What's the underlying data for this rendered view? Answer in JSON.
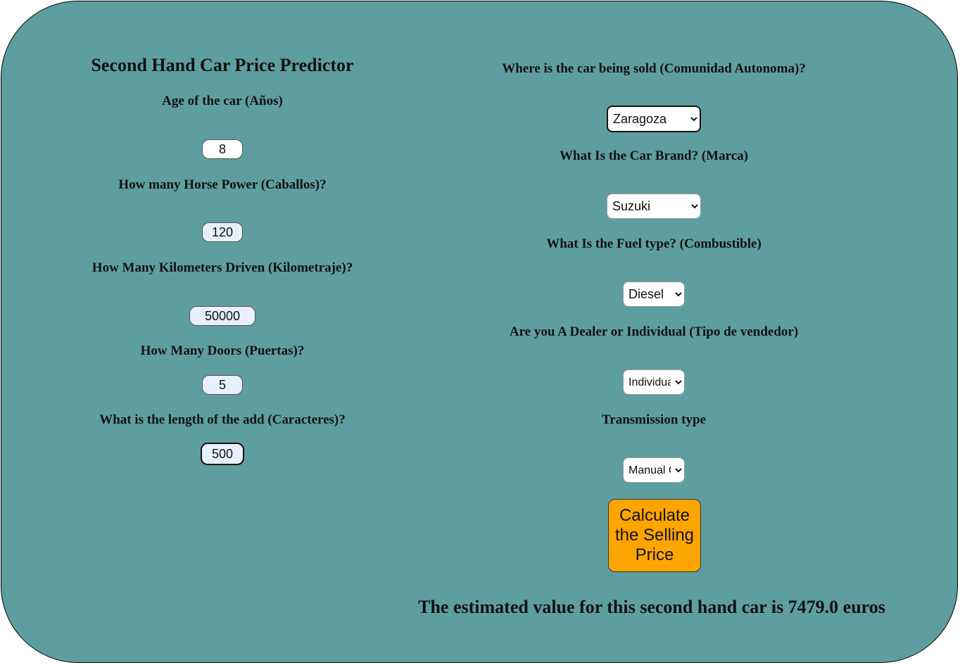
{
  "title": "Second Hand Car Price Predictor",
  "left": {
    "age": {
      "label": "Age of the car (Años)",
      "value": "8"
    },
    "hp": {
      "label": "How many Horse Power (Caballos)?",
      "value": "120"
    },
    "km": {
      "label": "How Many Kilometers Driven (Kilometraje)?",
      "value": "50000"
    },
    "doors": {
      "label": "How Many Doors (Puertas)?",
      "value": "5"
    },
    "chars": {
      "label": "What is the length of the add (Caracteres)?",
      "value": "500"
    }
  },
  "right": {
    "region": {
      "label": "Where is the car being sold (Comunidad Autonoma)?",
      "value": "Zaragoza"
    },
    "brand": {
      "label": "What Is the Car Brand? (Marca)",
      "value": "Suzuki"
    },
    "fuel": {
      "label": "What Is the Fuel type? (Combustible)",
      "value": "Diesel"
    },
    "seller": {
      "label": "Are you A Dealer or Individual (Tipo de vendedor)",
      "value": "Individual"
    },
    "transmission": {
      "label": "Transmission type",
      "value": "Manual C"
    }
  },
  "button": "Calculate the Selling Price",
  "result": "The estimated value for this second hand car is 7479.0 euros",
  "colors": {
    "background": "#5f9ea0",
    "button": "#ffa500"
  }
}
